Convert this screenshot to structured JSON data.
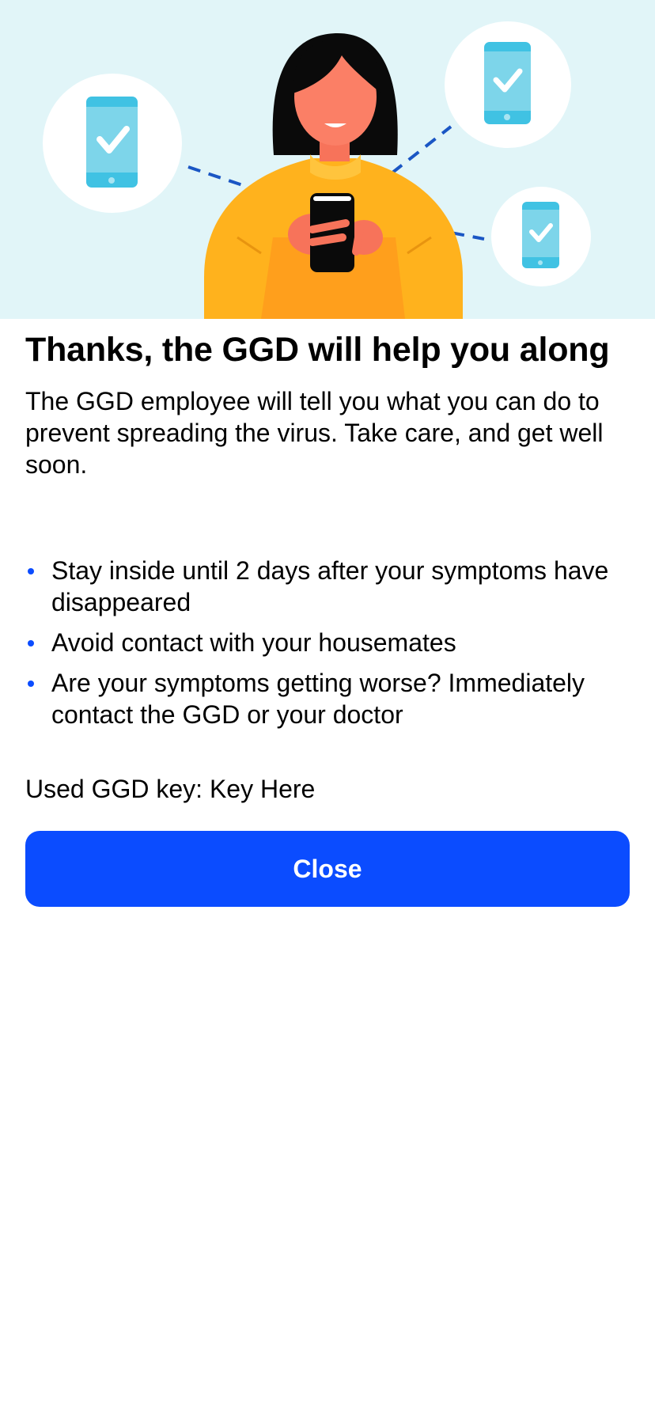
{
  "hero": {
    "illustration": "person-holding-phone-with-checkmark-phones",
    "icons": [
      "phone-check-icon",
      "phone-check-icon",
      "phone-check-icon"
    ],
    "background_color": "#e1f5f8"
  },
  "content": {
    "title": "Thanks, the GGD will help you along",
    "intro": "The GGD employee will tell you what you can do to prevent spreading the virus. Take care, and get well soon.",
    "bullets": [
      "Stay inside until 2 days after your symptoms have disappeared",
      "Avoid contact with your housemates",
      "Are your symptoms getting worse? Immediately contact the GGD or your doctor"
    ],
    "key_line": "Used GGD key: Key Here"
  },
  "actions": {
    "close_label": "Close"
  },
  "colors": {
    "accent": "#0b4cff",
    "text": "#000000",
    "phone_icon": "#3cbfe0",
    "sweater": "#ffb21d"
  }
}
